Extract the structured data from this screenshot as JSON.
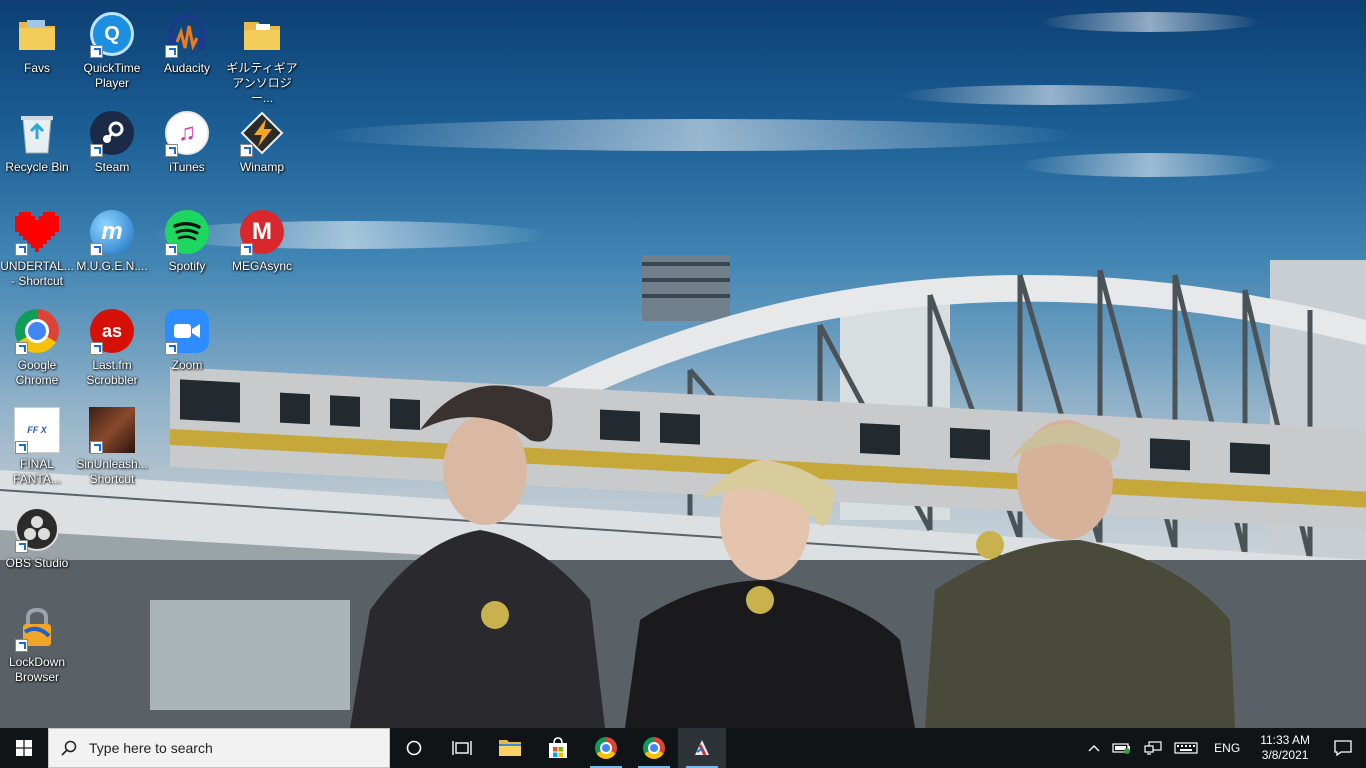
{
  "desktop": {
    "icons": [
      {
        "label": "Favs",
        "icon": "folder-icon"
      },
      {
        "label": "QuickTime Player",
        "icon": "quicktime-icon"
      },
      {
        "label": "Audacity",
        "icon": "audacity-icon"
      },
      {
        "label": "ギルティギアアンソロジー...",
        "icon": "folder-icon"
      },
      {
        "label": "Recycle Bin",
        "icon": "recycle-bin-icon"
      },
      {
        "label": "Steam",
        "icon": "steam-icon"
      },
      {
        "label": "iTunes",
        "icon": "itunes-icon"
      },
      {
        "label": "Winamp",
        "icon": "winamp-icon"
      },
      {
        "label": "UNDERTAL... - Shortcut",
        "icon": "heart-icon"
      },
      {
        "label": "M.U.G.E.N....",
        "icon": "mugen-icon"
      },
      {
        "label": "Spotify",
        "icon": "spotify-icon"
      },
      {
        "label": "MEGAsync",
        "icon": "mega-icon"
      },
      {
        "label": "Google Chrome",
        "icon": "chrome-icon"
      },
      {
        "label": "Last.fm Scrobbler",
        "icon": "lastfm-icon"
      },
      {
        "label": "Zoom",
        "icon": "zoom-icon"
      },
      {
        "label": "FINAL FANTA...",
        "icon": "final-fantasy-icon"
      },
      {
        "label": "SinUnleash... Shortcut",
        "icon": "game-icon"
      },
      {
        "label": "OBS Studio",
        "icon": "obs-icon"
      },
      {
        "label": "LockDown Browser",
        "icon": "lockdown-icon"
      }
    ]
  },
  "taskbar": {
    "search_placeholder": "Type here to search",
    "pinned": [
      {
        "name": "cortana",
        "icon": "circle-icon"
      },
      {
        "name": "task-view",
        "icon": "task-view-icon"
      },
      {
        "name": "file-explorer",
        "icon": "folder-icon"
      },
      {
        "name": "store",
        "icon": "store-icon"
      },
      {
        "name": "chrome",
        "icon": "chrome-icon"
      },
      {
        "name": "chrome-2",
        "icon": "chrome-icon"
      },
      {
        "name": "app",
        "icon": "app-icon"
      }
    ],
    "language": "ENG",
    "time": "11:33 AM",
    "date": "3/8/2021"
  },
  "colors": {
    "taskbar_bg": "#101417",
    "accent": "#76b9ed",
    "sky_top": "#0d3f73"
  }
}
